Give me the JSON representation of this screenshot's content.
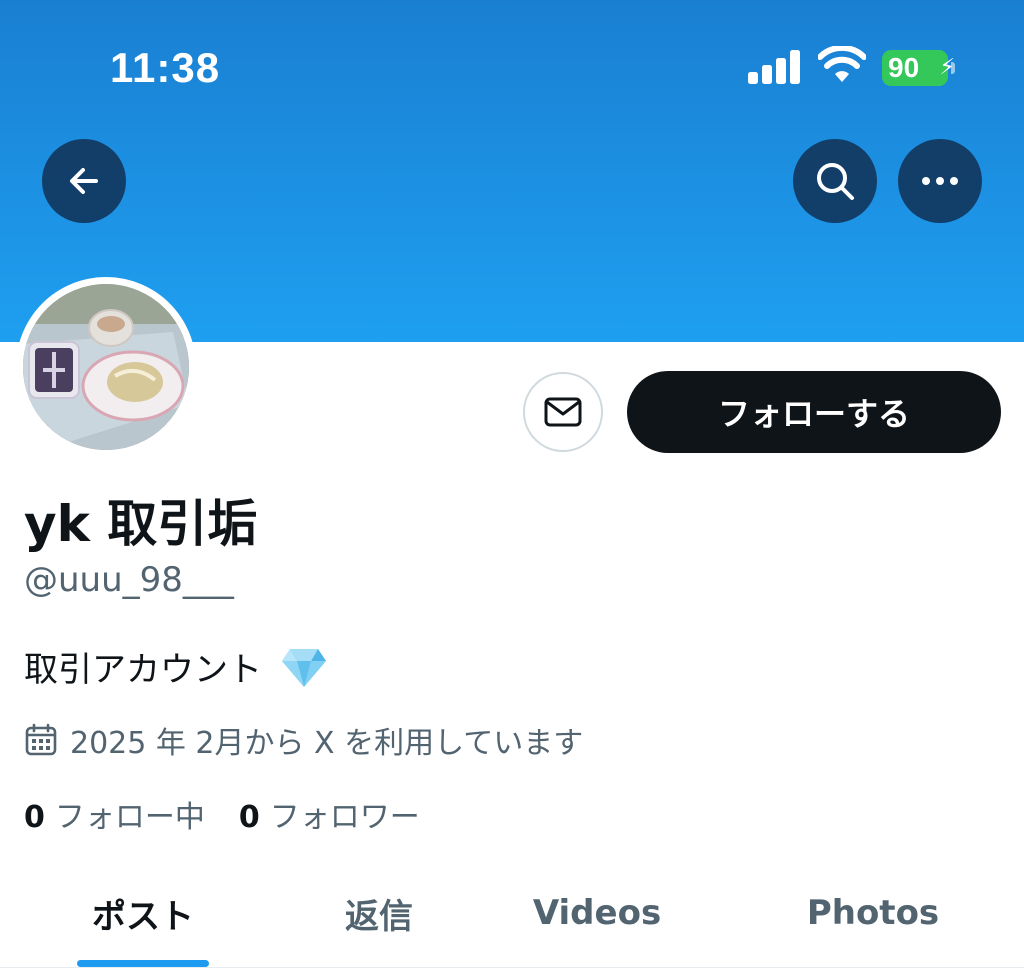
{
  "status_bar": {
    "time": "11:38",
    "battery_level": "90"
  },
  "colors": {
    "banner": "#1d94e6",
    "follow_button": "#0f1419",
    "accent": "#1d9bf0",
    "battery": "#34c759",
    "secondary_text": "#536471"
  },
  "nav": {
    "back_icon": "arrow-left-icon",
    "search_icon": "search-icon",
    "more_icon": "more-horizontal-icon"
  },
  "profile": {
    "display_name": "yk 取引垢",
    "handle": "@uuu_98___",
    "bio": "取引アカウント",
    "bio_emoji": "gem-icon",
    "joined": "2025 年 2月から X を利用しています",
    "following_count": "0",
    "following_label": "フォロー中",
    "followers_count": "0",
    "followers_label": "フォロワー"
  },
  "actions": {
    "message_icon": "mail-icon",
    "follow_label": "フォローする"
  },
  "tabs": [
    {
      "label": "ポスト",
      "active": true
    },
    {
      "label": "返信",
      "active": false
    },
    {
      "label": "Videos",
      "active": false
    },
    {
      "label": "Photos",
      "active": false
    }
  ]
}
